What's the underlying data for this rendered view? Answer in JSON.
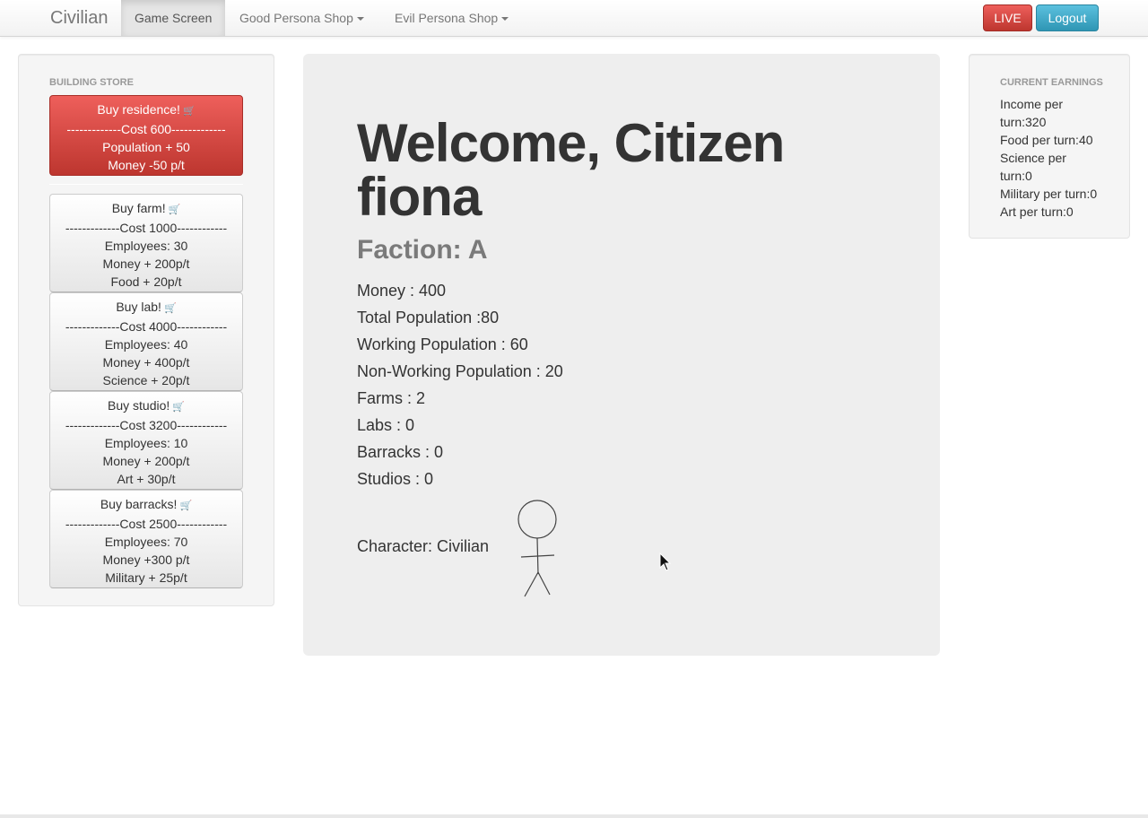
{
  "navbar": {
    "brand": "Civilian",
    "items": [
      {
        "label": "Game Screen"
      },
      {
        "label": "Good Persona Shop"
      },
      {
        "label": "Evil Persona Shop"
      }
    ],
    "live_label": "LIVE",
    "logout_label": "Logout"
  },
  "store": {
    "header": "BUILDING STORE",
    "items": [
      {
        "title": "Buy residence!",
        "lines": [
          "-------------Cost 600-------------",
          "Population + 50",
          "Money -50 p/t"
        ]
      },
      {
        "title": "Buy farm!",
        "lines": [
          "-------------Cost 1000------------",
          "Employees: 30",
          "Money + 200p/t",
          "Food + 20p/t"
        ]
      },
      {
        "title": "Buy lab!",
        "lines": [
          "-------------Cost 4000------------",
          "Employees: 40",
          "Money + 400p/t",
          "Science + 20p/t"
        ]
      },
      {
        "title": "Buy studio!",
        "lines": [
          "-------------Cost 3200------------",
          "Employees: 10",
          "Money + 200p/t",
          "Art + 30p/t"
        ]
      },
      {
        "title": "Buy barracks!",
        "lines": [
          "-------------Cost 2500------------",
          "Employees: 70",
          "Money +300 p/t",
          "Military + 25p/t"
        ]
      }
    ],
    "cart_icon": "shopping-cart-icon"
  },
  "main": {
    "welcome": "Welcome, Citizen fiona",
    "faction": "Faction: A",
    "stats": [
      "Money : 400",
      "Total Population :80",
      "Working Population : 60",
      "Non-Working Population : 20",
      "Farms : 2",
      "Labs : 0",
      "Barracks : 0",
      "Studios : 0"
    ],
    "character": "Character: Civilian"
  },
  "earnings": {
    "header": "CURRENT EARNINGS",
    "lines": [
      "Income per",
      "turn:320",
      "Food per turn:40",
      "Science per",
      "turn:0",
      "Military per turn:0",
      "Art per turn:0"
    ]
  },
  "colors": {
    "danger": "#bd362f",
    "info": "#2f96b4",
    "hero_bg": "#eeeeee"
  }
}
